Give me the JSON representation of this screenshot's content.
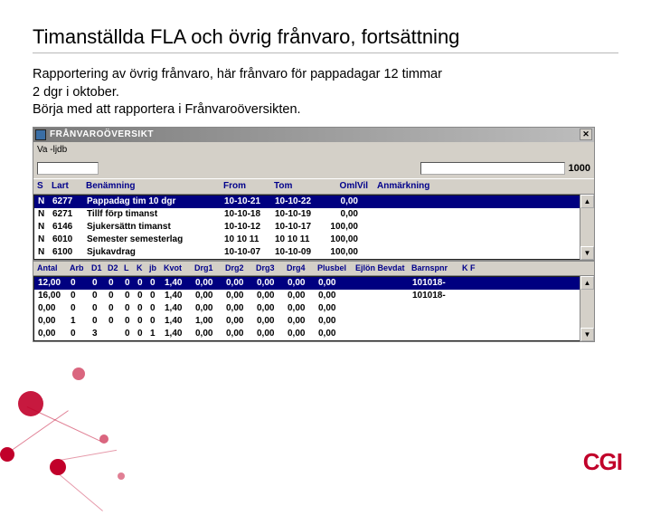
{
  "title": "Timanställda FLA och övrig frånvaro, fortsättning",
  "desc_line1": "Rapportering av övrig frånvaro, här frånvaro för pappadagar 12 timmar",
  "desc_line2": "2 dgr i oktober.",
  "desc_line3": "Börja med att rapportera i Frånvaroöversikten.",
  "window": {
    "title": "FRÅNVAROÖVERSIKT",
    "org_label": "Va   -ljdb",
    "date_code": "1000"
  },
  "hdr1": {
    "s": "S",
    "lart": "Lart",
    "ben": "Benämning",
    "from": "From",
    "tom": "Tom",
    "oml": "Oml",
    "vil": "Vil",
    "anm": "Anmärkning"
  },
  "rows1": [
    {
      "s": "N",
      "lart": "6277",
      "ben": "Pappadag tim 10 dgr",
      "from": "10-10-21",
      "tom": "10-10-22",
      "oml": "0,00"
    },
    {
      "s": "N",
      "lart": "6271",
      "ben": "Tillf förp timanst",
      "from": "10-10-18",
      "tom": "10-10-19",
      "oml": "0,00"
    },
    {
      "s": "N",
      "lart": "6146",
      "ben": "Sjukersättn timanst",
      "from": "10-10-12",
      "tom": "10-10-17",
      "oml": "100,00"
    },
    {
      "s": "N",
      "lart": "6010",
      "ben": "Semester semesterlag",
      "from": "10 10 11",
      "tom": "10 10 11",
      "oml": "100,00"
    },
    {
      "s": "N",
      "lart": "6100",
      "ben": "Sjukavdrag",
      "from": "10-10-07",
      "tom": "10-10-09",
      "oml": "100,00"
    }
  ],
  "hdr2": {
    "antal": "Antal",
    "arb": "Arb",
    "d1": "D1",
    "d2": "D2",
    "l": "L",
    "k": "K",
    "jb": "jb",
    "kvot": "Kvot",
    "drg1": "Drg1",
    "drg2": "Drg2",
    "drg3": "Drg3",
    "drg4": "Drg4",
    "plus": "Plusbel",
    "ejl": "Ejlön Bevdat",
    "bsp": "Barnspnr",
    "kf": "K F"
  },
  "rows2": [
    {
      "antal": "12,00",
      "arb": "0",
      "d1": "0",
      "d2": "0",
      "l": "0",
      "k": "0",
      "jb": "0",
      "kvot": "1,40",
      "drg1": "0,00",
      "drg2": "0,00",
      "drg3": "0,00",
      "drg4": "0,00",
      "plus": "0,00",
      "bsp": "101018-"
    },
    {
      "antal": "16,00",
      "arb": "0",
      "d1": "0",
      "d2": "0",
      "l": "0",
      "k": "0",
      "jb": "0",
      "kvot": "1,40",
      "drg1": "0,00",
      "drg2": "0,00",
      "drg3": "0,00",
      "drg4": "0,00",
      "plus": "0,00",
      "bsp": "101018-"
    },
    {
      "antal": "0,00",
      "arb": "0",
      "d1": "0",
      "d2": "0",
      "l": "0",
      "k": "0",
      "jb": "0",
      "kvot": "1,40",
      "drg1": "0,00",
      "drg2": "0,00",
      "drg3": "0,00",
      "drg4": "0,00",
      "plus": "0,00",
      "bsp": ""
    },
    {
      "antal": "0,00",
      "arb": "1",
      "d1": "0",
      "d2": "0",
      "l": "0",
      "k": "0",
      "jb": "0",
      "kvot": "1,40",
      "drg1": "1,00",
      "drg2": "0,00",
      "drg3": "0,00",
      "drg4": "0,00",
      "plus": "0,00",
      "bsp": ""
    },
    {
      "antal": "0,00",
      "arb": "0",
      "d1": "3",
      "d2": "",
      "l": "0",
      "k": "0",
      "jb": "1",
      "kvot": "1,40",
      "drg1": "0,00",
      "drg2": "0,00",
      "drg3": "0,00",
      "drg4": "0,00",
      "plus": "0,00",
      "bsp": ""
    }
  ],
  "logo": "CGI"
}
